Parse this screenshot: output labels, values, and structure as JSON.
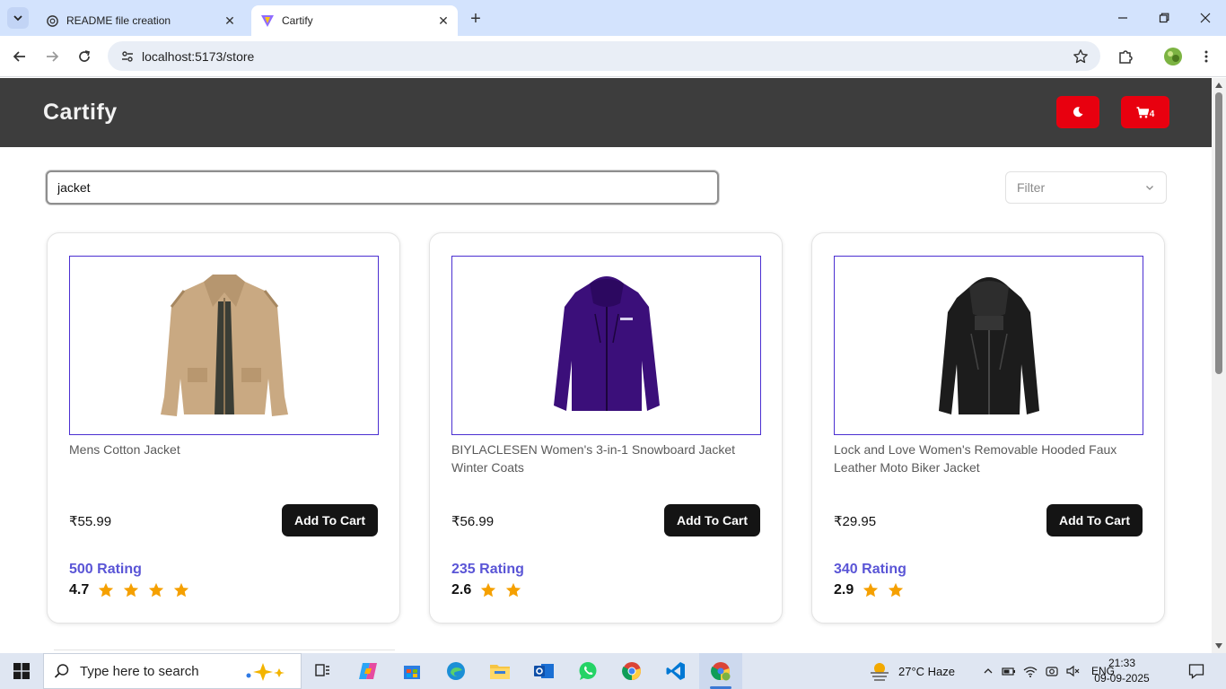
{
  "browser": {
    "tabs": [
      {
        "title": "README file creation",
        "icon": "openai-icon"
      },
      {
        "title": "Cartify",
        "icon": "vite-icon"
      }
    ],
    "url": "localhost:5173/store"
  },
  "app": {
    "brand": "Cartify",
    "cart_count": "4",
    "accent_color": "#e8000f",
    "header_color": "#3d3d3d"
  },
  "search": {
    "value": "jacket",
    "filter_placeholder": "Filter"
  },
  "products": [
    {
      "title": "Mens Cotton Jacket",
      "price": "₹55.99",
      "button": "Add To Cart",
      "rating_count": "500 Rating",
      "rating_value": "4.7",
      "stars": 4,
      "image": "beige cotton jacket"
    },
    {
      "title": "BIYLACLESEN Women's 3-in-1 Snowboard Jacket Winter Coats",
      "price": "₹56.99",
      "button": "Add To Cart",
      "rating_count": "235 Rating",
      "rating_value": "2.6",
      "stars": 2,
      "image": "purple snowboard jacket"
    },
    {
      "title": "Lock and Love Women's Removable Hooded Faux Leather Moto Biker Jacket",
      "price": "₹29.95",
      "button": "Add To Cart",
      "rating_count": "340 Rating",
      "rating_value": "2.9",
      "stars": 2,
      "image": "black leather biker jacket"
    }
  ],
  "taskbar": {
    "search_placeholder": "Type here to search",
    "weather": "27°C  Haze",
    "language": "ENG",
    "time": "21:33",
    "date": "09-09-2025"
  }
}
